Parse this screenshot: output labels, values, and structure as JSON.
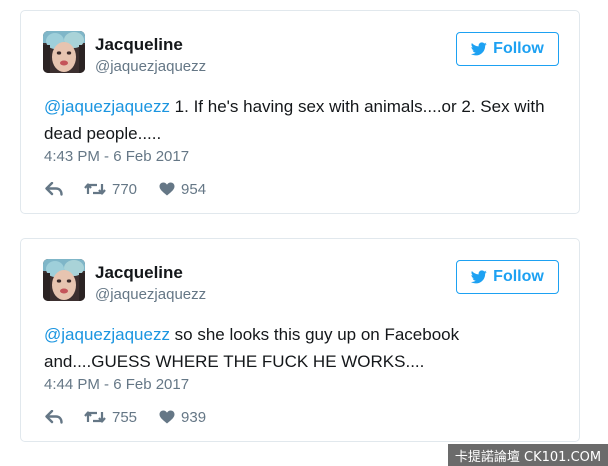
{
  "colors": {
    "twitter_blue": "#1da1f2",
    "mention_blue": "#1b95e0",
    "secondary_text": "#657786",
    "primary_text": "#14171a",
    "card_border": "#e1e8ed"
  },
  "tweets": [
    {
      "author": {
        "name": "Jacqueline",
        "handle": "@jaquezjaquezz",
        "avatar_icon": "profile-photo"
      },
      "follow_label": "Follow",
      "mention": "@jaquezjaquezz",
      "text": " 1. If he's having sex with animals....or 2. Sex with dead people.....",
      "timestamp": "4:43 PM - 6 Feb 2017",
      "retweets": "770",
      "likes": "954",
      "icons": [
        "reply-icon",
        "retweet-icon",
        "heart-icon",
        "twitter-bird-icon"
      ]
    },
    {
      "author": {
        "name": "Jacqueline",
        "handle": "@jaquezjaquezz",
        "avatar_icon": "profile-photo"
      },
      "follow_label": "Follow",
      "mention": "@jaquezjaquezz",
      "text": " so she looks this guy up on Facebook and....GUESS WHERE THE FUCK HE WORKS....",
      "timestamp": "4:44 PM - 6 Feb 2017",
      "retweets": "755",
      "likes": "939",
      "icons": [
        "reply-icon",
        "retweet-icon",
        "heart-icon",
        "twitter-bird-icon"
      ]
    }
  ],
  "watermark": "卡提諾論壇 CK101.COM"
}
